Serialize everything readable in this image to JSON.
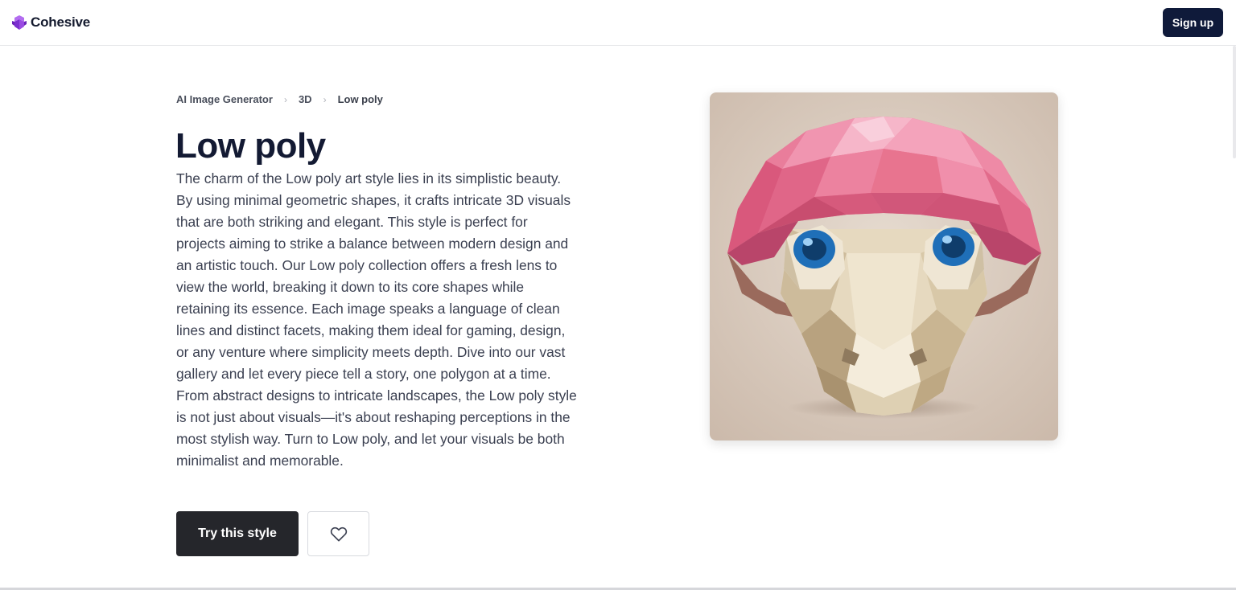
{
  "header": {
    "brand_name": "Cohesive",
    "signup_label": "Sign up"
  },
  "breadcrumb": {
    "items": [
      "AI Image Generator",
      "3D"
    ],
    "current": "Low poly"
  },
  "main": {
    "title": "Low poly",
    "description": "The charm of the Low poly art style lies in its simplistic beauty. By using minimal geometric shapes, it crafts intricate 3D visuals that are both striking and elegant. This style is perfect for projects aiming to strike a balance between modern design and an artistic touch. Our Low poly collection offers a fresh lens to view the world, breaking it down to its core shapes while retaining its essence. Each image speaks a language of clean lines and distinct facets, making them ideal for gaming, design, or any venture where simplicity meets depth. Dive into our vast gallery and let every piece tell a story, one polygon at a time. From abstract designs to intricate landscapes, the Low poly style is not just about visuals—it's about reshaping perceptions in the most stylish way. Turn to Low poly, and let your visuals be both minimalist and memorable.",
    "try_label": "Try this style",
    "favorite_icon": "heart-icon"
  },
  "hero_image": {
    "subject": "low poly pink mushroom with blue eyes"
  },
  "colors": {
    "brand_logo": "#8b3fd6",
    "signup_bg": "#0f1a3a",
    "try_bg": "#25262b",
    "title": "#131a33",
    "mushroom_cap": "#e36a8c",
    "mushroom_stem": "#e8dcc4",
    "eye_iris": "#1f6fb8",
    "image_bg": "#d9cbbe"
  }
}
